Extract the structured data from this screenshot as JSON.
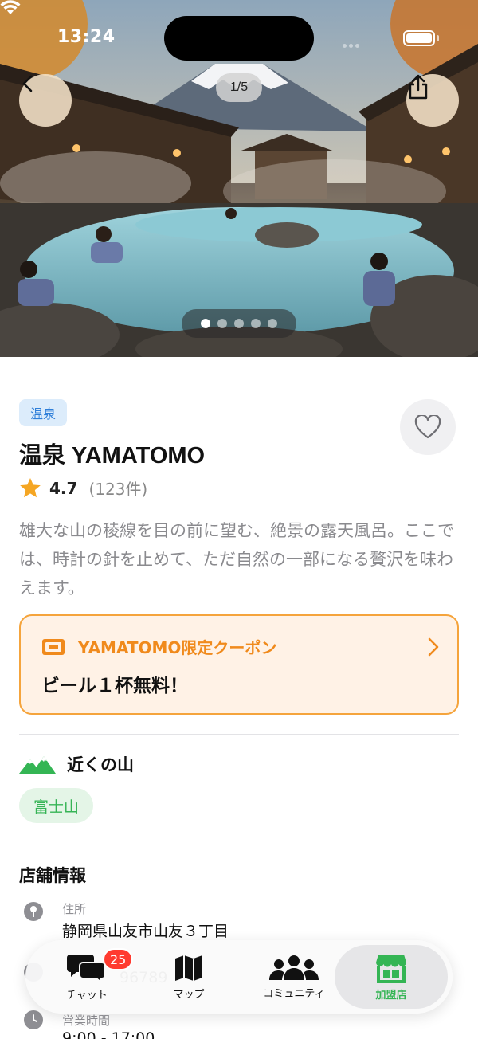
{
  "status_bar": {
    "time": "13:24"
  },
  "hero": {
    "counter": "1/5",
    "dots_total": 5,
    "dots_active_index": 0
  },
  "place": {
    "category_tag": "温泉",
    "name": "温泉 YAMATOMO",
    "rating": "4.7",
    "review_count": "(123件)",
    "description": "雄大な山の稜線を目の前に望む、絶景の露天風呂。ここでは、時計の針を止めて、ただ自然の一部になる贅沢を味わえます。"
  },
  "coupon": {
    "label": "YAMATOMO限定クーポン",
    "text": "ビール１杯無料！"
  },
  "nearby_mountains": {
    "heading": "近くの山",
    "items": [
      "富士山"
    ]
  },
  "shop_info": {
    "heading": "店舗情報",
    "address_label": "住所",
    "address_value": "静岡県山友市山友３丁目",
    "phone_partial": "96789",
    "hours_label": "営業時間",
    "hours_value": "9:00 - 17:00"
  },
  "tab_bar": {
    "chat": {
      "label": "チャット",
      "badge": "25"
    },
    "map": {
      "label": "マップ"
    },
    "community": {
      "label": "コミュニティ"
    },
    "shop": {
      "label": "加盟店"
    }
  },
  "colors": {
    "accent_green": "#34b554",
    "coupon_orange": "#f08a1c",
    "tag_blue": "#2f7fd9",
    "badge_red": "#ff3b30",
    "star": "#f5a623"
  }
}
